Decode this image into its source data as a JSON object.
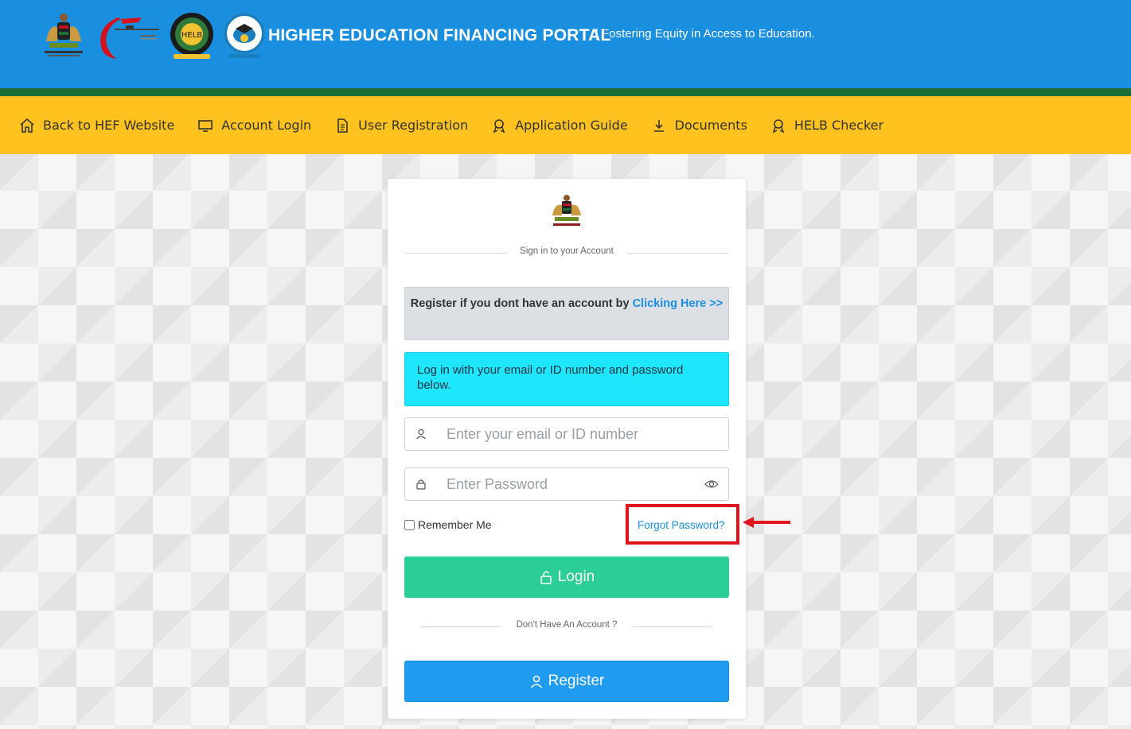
{
  "header": {
    "title": "HIGHER EDUCATION FINANCING PORTAL",
    "tagline": "| Fostering Equity in Access to Education.",
    "logos": [
      {
        "icon": "coat-of-arms-icon"
      },
      {
        "icon": "ministry-logo-icon"
      },
      {
        "icon": "helb-logo-icon"
      },
      {
        "icon": "kuccps-logo-icon"
      }
    ],
    "colors": {
      "blue": "#1a8fdf",
      "green": "#1d6f35",
      "yellow": "#ffc21e"
    }
  },
  "nav": {
    "items": [
      {
        "label": "Back to HEF Website",
        "icon": "home-icon"
      },
      {
        "label": "Account Login",
        "icon": "monitor-icon"
      },
      {
        "label": "User Registration",
        "icon": "document-icon"
      },
      {
        "label": "Application Guide",
        "icon": "award-icon"
      },
      {
        "label": "Documents",
        "icon": "download-icon"
      },
      {
        "label": "HELB Checker",
        "icon": "award-icon"
      }
    ]
  },
  "login_card": {
    "signin_caption": "Sign in to your Account",
    "register_prompt": "Register if you dont have an account by",
    "register_link": "Clicking Here >>",
    "info_message": "Log in with your email or ID number and password below.",
    "email_placeholder": "Enter your email or ID number",
    "password_placeholder": "Enter Password",
    "remember_label": "Remember Me",
    "forgot_label": "Forgot Password?",
    "login_label": "Login",
    "no_account_caption": "Don't Have An Account ?",
    "register_label": "Register",
    "colors": {
      "login_button": "#2bce95",
      "register_button": "#1f9bef",
      "info_box": "#1de6fd",
      "highlight": "#e1141b"
    }
  }
}
